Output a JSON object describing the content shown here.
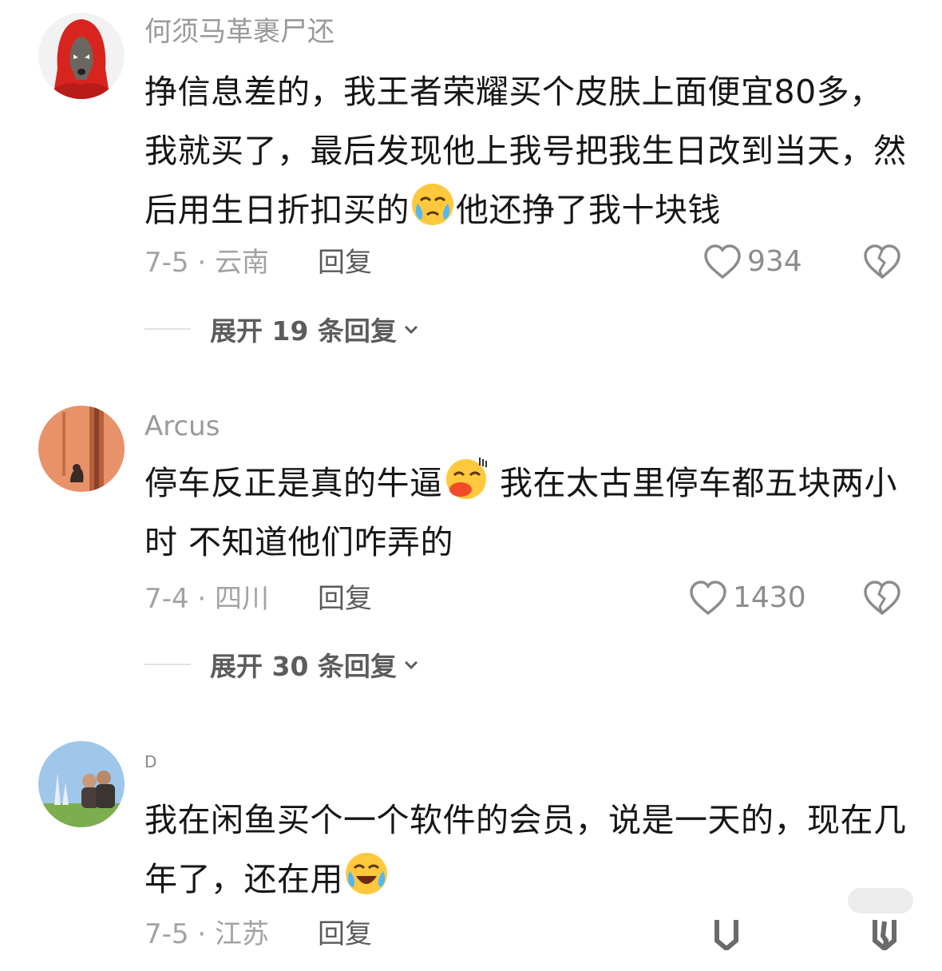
{
  "comments": [
    {
      "username": "何须马革裹尸还",
      "text_before": "挣信息差的，我王者荣耀买个皮肤上面便宜80多，我就买了，最后发现他上我号把我生日改到当天，然后用生日折扣买的",
      "text_after": "他还挣了我十块钱",
      "emoji": "crying-face-emoji",
      "date_location": "7-5 · 云南",
      "reply_label": "回复",
      "likes": "934",
      "expand_label": "展开 19 条回复"
    },
    {
      "username": "Arcus",
      "text_before": "停车反正是真的牛逼",
      "text_after": " 我在太古里停车都五块两小时 不知道他们咋弄的",
      "emoji": "kiss-face-emoji",
      "date_location": "7-4 · 四川",
      "reply_label": "回复",
      "likes": "1430",
      "expand_label": "展开 30 条回复"
    },
    {
      "username": "D",
      "text_before": "我在闲鱼买个一个软件的会员，说是一天的，现在几年了，还在用",
      "text_after": "",
      "emoji": "laugh-cry-emoji",
      "date_location": "7-5 · 江苏",
      "reply_label": "回复"
    }
  ],
  "colors": {
    "username": "#9a9a9a",
    "body": "#161616",
    "meta": "#a3a3a3",
    "icon": "#8c8c8c"
  }
}
